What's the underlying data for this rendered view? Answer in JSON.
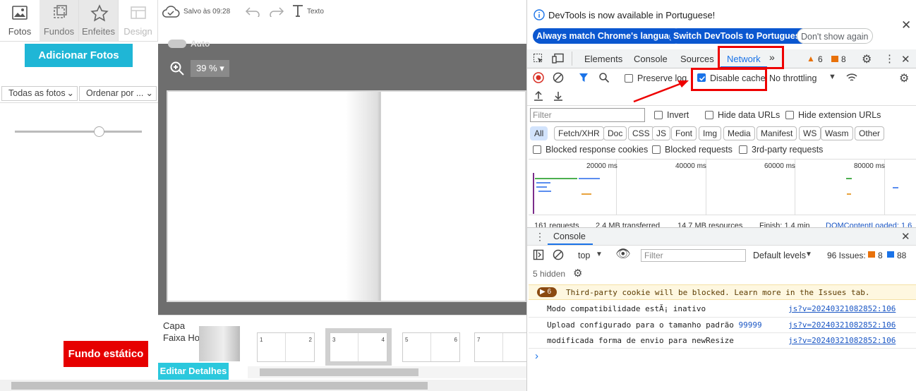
{
  "left_panel": {
    "tabs": [
      {
        "label": "Fotos",
        "icon": "image-icon"
      },
      {
        "label": "Fundos",
        "icon": "crop-icon"
      },
      {
        "label": "Enfeites",
        "icon": "star-icon"
      },
      {
        "label": "Design",
        "icon": "layout-icon"
      }
    ],
    "add_photos": "Adicionar Fotos",
    "filter_select": "Todas as fotos",
    "sort_select": "Ordenar por ...",
    "bg_button": "Fundo estático"
  },
  "editor": {
    "saved_text": "Salvo às 09:28",
    "text_tool": "Texto",
    "auto_label": "Auto",
    "zoom": "39 %",
    "strip": {
      "capa": "Capa",
      "faixa": "Faixa Horizontal",
      "edit": "Editar Detalhes",
      "thumbs": [
        {
          "l": "1",
          "r": "2"
        },
        {
          "l": "3",
          "r": "4"
        },
        {
          "l": "5",
          "r": "6"
        },
        {
          "l": "7",
          "r": ""
        }
      ]
    }
  },
  "devtools": {
    "banner": {
      "text": "DevTools is now available in Portuguese!",
      "always": "Always match Chrome's language",
      "switch": "Switch DevTools to Portuguese",
      "dont": "Don't show again"
    },
    "tabs": [
      "Elements",
      "Console",
      "Sources",
      "Network"
    ],
    "warn_count": "6",
    "issue_count": "8",
    "preserve_log": "Preserve log",
    "disable_cache": "Disable cache",
    "throttling": "No throttling",
    "filter_placeholder": "Filter",
    "invert": "Invert",
    "hide_data": "Hide data URLs",
    "hide_ext": "Hide extension URLs",
    "types": [
      "All",
      "Fetch/XHR",
      "Doc",
      "CSS",
      "JS",
      "Font",
      "Img",
      "Media",
      "Manifest",
      "WS",
      "Wasm",
      "Other"
    ],
    "blocked_cookies": "Blocked response cookies",
    "blocked_requests": "Blocked requests",
    "third_party": "3rd-party requests",
    "timeline_labels": [
      "20000 ms",
      "40000 ms",
      "60000 ms",
      "80000 ms"
    ],
    "summary": [
      "161 requests",
      "2.4 MB transferred",
      "14.7 MB resources",
      "Finish: 1.4 min",
      "DOMContentLoaded: 1.6"
    ],
    "console_tab": "Console",
    "context": "top",
    "console_filter": "Filter",
    "levels": "Default levels",
    "issues_label": "96 Issues:",
    "issues_warn": "8",
    "issues_info": "88",
    "hidden": "5 hidden",
    "warn_badge": "6",
    "warn_msg": "Third-party cookie will be blocked. Learn more in the Issues tab.",
    "messages": [
      {
        "text": "Modo compatibilidade estÃ¡ inativo",
        "link": "js?v=20240321082852:106"
      },
      {
        "text": "Upload configurado para o tamanho padrão ",
        "num": "99999",
        "link": "js?v=20240321082852:106"
      },
      {
        "text": "modificada forma de envio para newResize",
        "link": "js?v=20240321082852:106"
      }
    ],
    "prompt": "›"
  }
}
